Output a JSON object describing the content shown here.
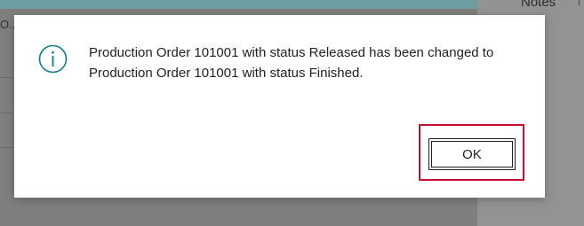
{
  "background": {
    "column_header_text": "O...",
    "notes_label": "Notes",
    "colors": {
      "overlay": "#7f7f7f",
      "header_teal": "#6e9ea2"
    }
  },
  "dialog": {
    "icon": "info-icon",
    "icon_color": "#0f7b85",
    "message": "Production Order 101001 with status Released has been changed to Production Order 101001 with status Finished.",
    "ok_label": "OK",
    "highlight_color": "#c8102e"
  }
}
